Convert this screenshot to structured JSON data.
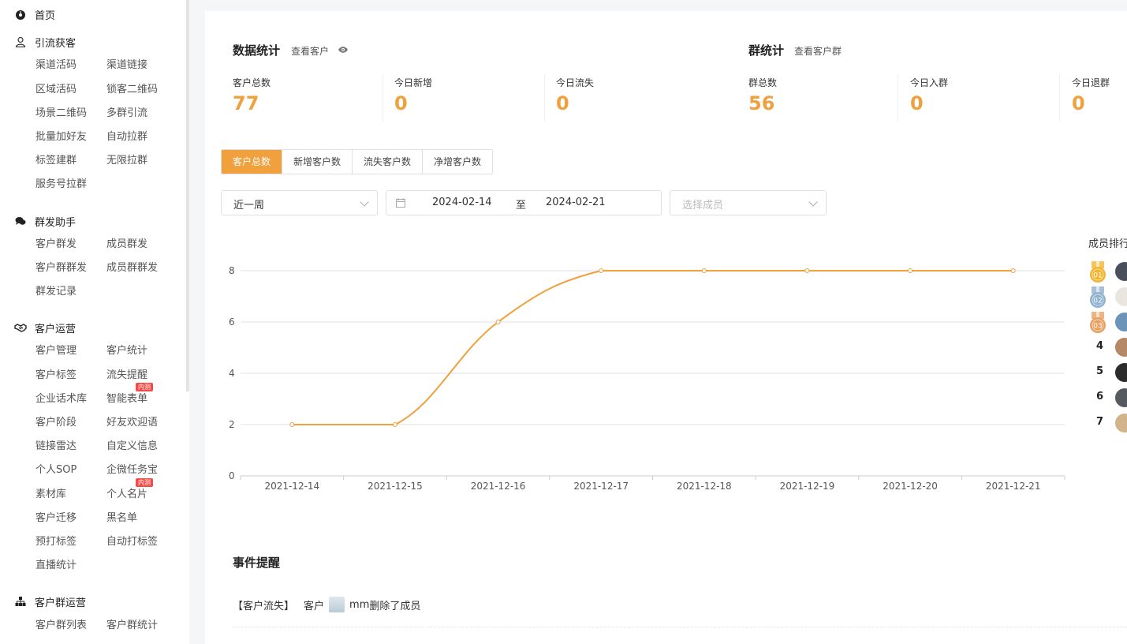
{
  "sidebar": {
    "sections": [
      {
        "id": "home",
        "label": "首页",
        "icon": "dashboard-icon"
      },
      {
        "id": "acquire",
        "label": "引流获客",
        "icon": "user-icon"
      },
      {
        "id": "mass",
        "label": "群发助手",
        "icon": "chat-bubbles-icon"
      },
      {
        "id": "ops",
        "label": "客户运营",
        "icon": "handshake-icon"
      },
      {
        "id": "group_ops",
        "label": "客户群运营",
        "icon": "org-chart-icon"
      }
    ],
    "acquire_items": [
      "渠道活码",
      "渠道链接",
      "区域活码",
      "锁客二维码",
      "场景二维码",
      "多群引流",
      "批量加好友",
      "自动拉群",
      "标签建群",
      "无限拉群",
      "服务号拉群"
    ],
    "mass_items": [
      "客户群发",
      "成员群发",
      "客户群群发",
      "成员群群发",
      "群发记录"
    ],
    "ops_items": [
      "客户管理",
      "客户统计",
      "客户标签",
      "流失提醒",
      "企业话术库",
      "智能表单",
      "客户阶段",
      "好友欢迎语",
      "链接雷达",
      "自定义信息",
      "个人SOP",
      "企微任务宝",
      "素材库",
      "个人名片",
      "客户迁移",
      "黑名单",
      "预打标签",
      "自动打标签",
      "直播统计"
    ],
    "group_ops_items": [
      "客户群列表",
      "客户群统计"
    ],
    "badge": "内测"
  },
  "stats": {
    "title": "数据统计",
    "link": "查看客户",
    "items": [
      {
        "label": "客户总数",
        "value": "77"
      },
      {
        "label": "今日新增",
        "value": "0"
      },
      {
        "label": "今日流失",
        "value": "0"
      }
    ]
  },
  "group_stats": {
    "title": "群统计",
    "link": "查看客户群",
    "items": [
      {
        "label": "群总数",
        "value": "56"
      },
      {
        "label": "今日入群",
        "value": "0"
      },
      {
        "label": "今日退群",
        "value": "0"
      }
    ]
  },
  "tabs": [
    "客户总数",
    "新增客户数",
    "流失客户数",
    "净增客户数"
  ],
  "filters": {
    "period": "近一周",
    "date_start": "2024-02-14",
    "date_sep": "至",
    "date_end": "2024-02-21",
    "member_placeholder": "选择成员"
  },
  "chart_data": {
    "type": "line",
    "x": [
      "2021-12-14",
      "2021-12-15",
      "2021-12-16",
      "2021-12-17",
      "2021-12-18",
      "2021-12-19",
      "2021-12-20",
      "2021-12-21"
    ],
    "series": [
      {
        "values": [
          2,
          2,
          6,
          8,
          8,
          8,
          8,
          8
        ]
      }
    ],
    "yticks": [
      0,
      2,
      4,
      6,
      8
    ],
    "ylim": [
      0,
      8
    ],
    "color": "#f0a03c",
    "smooth": true,
    "grid": true
  },
  "ranking": {
    "title": "成员排行",
    "ranks": [
      "01",
      "02",
      "03",
      "4",
      "5",
      "6",
      "7"
    ],
    "medal_colors": [
      "#f2b531",
      "#8eb2cf",
      "#e8a062"
    ]
  },
  "events": {
    "title": "事件提醒",
    "items": [
      {
        "tag": "【客户流失】",
        "prefix": "客户",
        "name": "mm",
        "text": "删除了成员"
      }
    ]
  }
}
